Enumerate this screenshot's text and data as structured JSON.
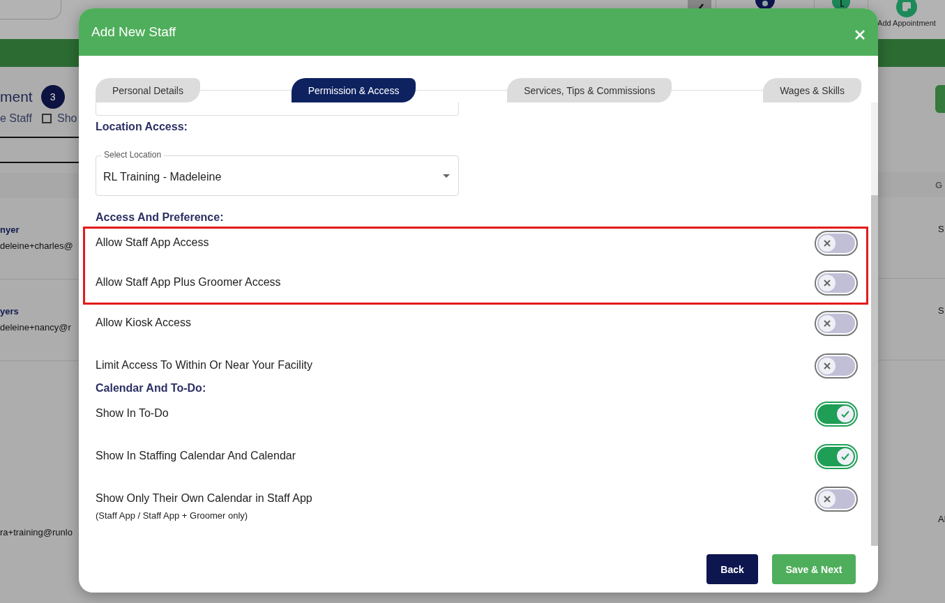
{
  "background": {
    "top_bar": {
      "action_label": "Add Appointment"
    },
    "page_title": "ment",
    "count": "3",
    "filter_label": "e Staff",
    "show_checkbox": {
      "label": "Sho",
      "checked": false
    },
    "table": {
      "column_header": "G",
      "rows": [
        {
          "name": "nyer",
          "email": "deleine+charles@",
          "column_right": "S"
        },
        {
          "name": "yers",
          "email": "deleine+nancy@r",
          "column_right": "S"
        },
        {
          "email": "ra+training@runlo",
          "column_right": "Al"
        }
      ]
    }
  },
  "modal": {
    "title": "Add New Staff",
    "steps": [
      {
        "label": "Personal Details",
        "selected": false
      },
      {
        "label": "Permission & Access",
        "selected": true
      },
      {
        "label": "Services, Tips & Commissions",
        "selected": false
      },
      {
        "label": "Wages & Skills",
        "selected": false
      }
    ],
    "sections": [
      {
        "kind": "select",
        "heading": "Location Access:",
        "field": {
          "label": "Select Location",
          "value": "RL Training - Madeleine"
        }
      },
      {
        "kind": "toggles",
        "heading": "Access And Preference:",
        "highlighted_rows": [
          {
            "label": "Allow Staff App Access",
            "on": false
          },
          {
            "label": "Allow Staff App Plus Groomer Access",
            "on": false
          }
        ],
        "rows": [
          {
            "label": "Allow Kiosk Access",
            "on": false
          },
          {
            "label": "Limit Access To Within Or Near Your Facility",
            "on": false
          }
        ]
      },
      {
        "kind": "toggles",
        "heading": "Calendar And To-Do:",
        "rows": [
          {
            "label": "Show In To-Do",
            "on": true
          },
          {
            "label": "Show In Staffing Calendar And Calendar",
            "on": true
          },
          {
            "label": "Show Only Their Own Calendar in Staff App",
            "note": "(Staff App / Staff App + Groomer only)",
            "on": false
          }
        ]
      }
    ],
    "buttons": [
      {
        "label": "Back",
        "kind": "secondary"
      },
      {
        "label": "Save & Next",
        "kind": "primary"
      }
    ]
  }
}
